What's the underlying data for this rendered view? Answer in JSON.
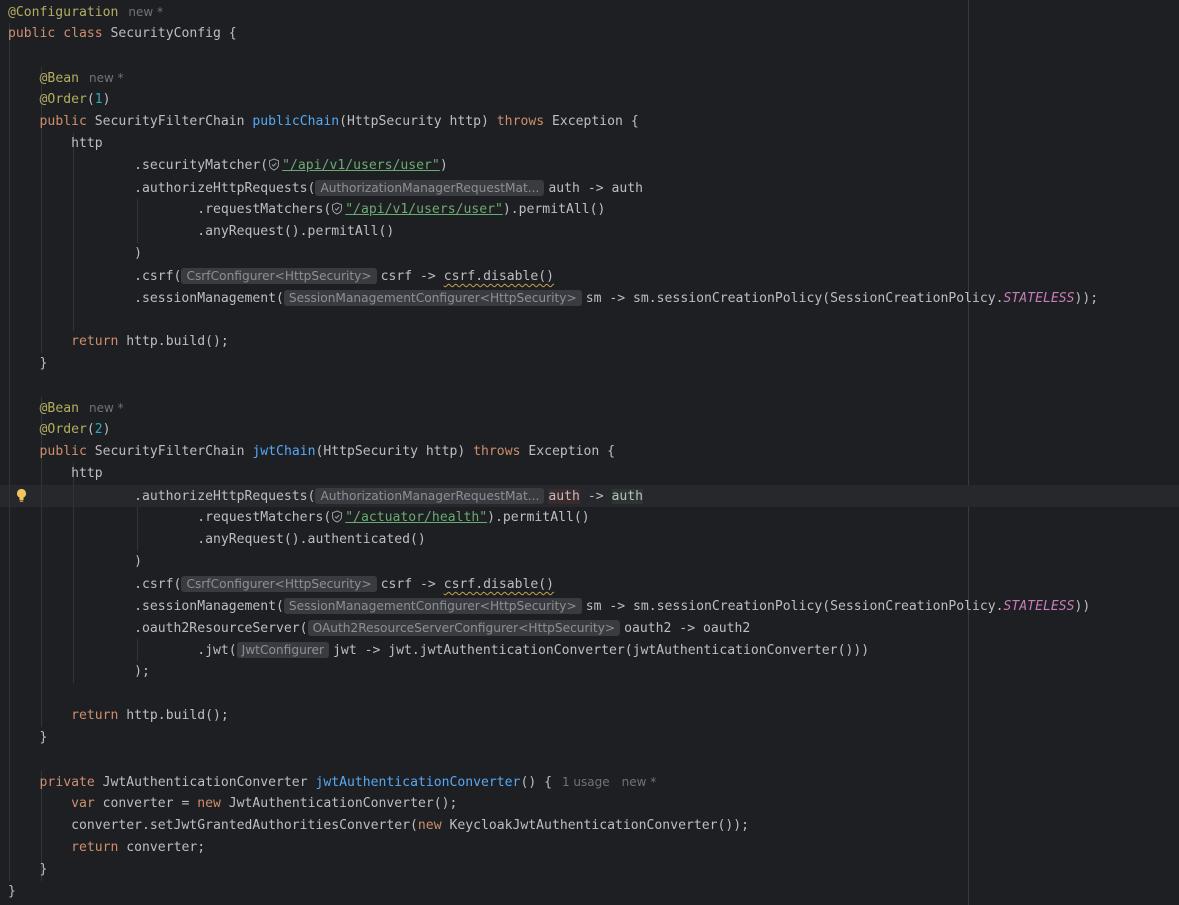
{
  "editor": {
    "meta_new": "new *",
    "meta_usage": "1 usage",
    "hints": {
      "authz": "AuthorizationManagerRequestMat...",
      "csrf": "CsrfConfigurer<HttpSecurity>",
      "session": "SessionManagementConfigurer<HttpSecurity>",
      "oauth2": "OAuth2ResourceServerConfigurer<HttpSecurity>",
      "jwt": "JwtConfigurer"
    },
    "strings": {
      "users_user": "\"/api/v1/users/user\"",
      "actuator": "\"/actuator/health\""
    },
    "constants": {
      "stateless": "STATELESS"
    }
  }
}
